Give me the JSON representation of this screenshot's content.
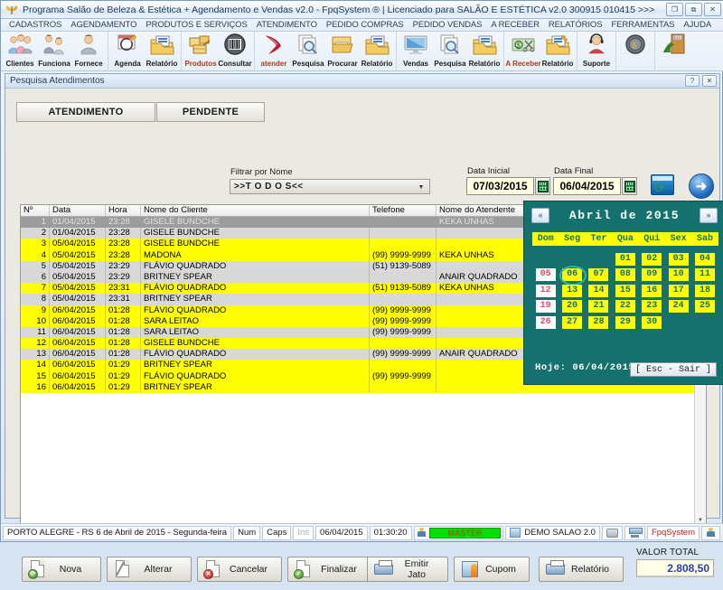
{
  "window": {
    "title": "Programa Salão de Beleza & Estética + Agendamento e Vendas v2.0 - FpqSystem ® | Licenciado para  SALÃO E ESTÉTICA v2.0 300915 010415 >>>",
    "app_icon": "butterfly-icon",
    "buttons": {
      "minimize": "❐",
      "maximize": "⧉",
      "close": "✕"
    }
  },
  "menubar": [
    "CADASTROS",
    "AGENDAMENTO",
    "PRODUTOS E SERVIÇOS",
    "ATENDIMENTO",
    "PEDIDO COMPRAS",
    "PEDIDO VENDAS",
    "A RECEBER",
    "RELATÓRIOS",
    "FERRAMENTAS",
    "AJUDA"
  ],
  "toolbar": {
    "groups": [
      {
        "items": [
          {
            "label": "Clientes",
            "icon": "clients-group-icon",
            "red": false
          },
          {
            "label": "Funciona",
            "icon": "employees-icon",
            "red": false
          },
          {
            "label": "Fornece",
            "icon": "supplier-icon",
            "red": false
          }
        ]
      },
      {
        "items": [
          {
            "label": "Agenda",
            "icon": "calendar-pencil-icon",
            "red": false
          },
          {
            "label": "Relatório",
            "icon": "report-folder-icon",
            "red": false
          }
        ]
      },
      {
        "items": [
          {
            "label": "Produtos",
            "icon": "boxes-icon",
            "red": true
          },
          {
            "label": "Consultar",
            "icon": "barcode-icon",
            "red": false
          }
        ]
      },
      {
        "items": [
          {
            "label": "atender",
            "icon": "red-ribbon-icon",
            "red": true
          },
          {
            "label": "Pesquisa",
            "icon": "search-docs-icon",
            "red": false
          },
          {
            "label": "Procurar",
            "icon": "open-folder-icon",
            "red": false
          },
          {
            "label": "Relatório",
            "icon": "report-folder-icon",
            "red": false
          }
        ]
      },
      {
        "items": [
          {
            "label": "Vendas",
            "icon": "monitor-icon",
            "red": false
          },
          {
            "label": "Pesquisa",
            "icon": "search-docs-icon",
            "red": false
          },
          {
            "label": "Relatório",
            "icon": "report-folder-icon",
            "red": false
          }
        ]
      },
      {
        "items": [
          {
            "label": "A Receber",
            "icon": "money-scissors-icon",
            "red": true
          },
          {
            "label": "Relatório",
            "icon": "report-folder-gear-icon",
            "red": false
          }
        ]
      },
      {
        "items": [
          {
            "label": "Suporte",
            "icon": "headset-support-icon",
            "red": false
          }
        ]
      },
      {
        "items": [
          {
            "label": "",
            "icon": "coin-icon",
            "red": false
          }
        ]
      },
      {
        "items": [
          {
            "label": "",
            "icon": "exit-door-icon",
            "red": false
          }
        ]
      }
    ]
  },
  "child_window": {
    "title": "Pesquisa Atendimentos",
    "help_button": "?",
    "close_button": "✕",
    "tabs": [
      {
        "id": "atendimento",
        "label": "ATENDIMENTO",
        "active": true
      },
      {
        "id": "pendente",
        "label": "PENDENTE",
        "active": false
      }
    ],
    "filter": {
      "label": "Filtrar por Nome",
      "value": ">>T O D O S<<",
      "placeholder": ">>T O D O S<<"
    },
    "date_initial": {
      "label": "Data Inicial",
      "value": "07/03/2015"
    },
    "date_final": {
      "label": "Data Final",
      "value": "06/04/2015"
    },
    "refresh_icon": "refresh-window-icon",
    "go_icon": "arrow-right-circle-icon"
  },
  "grid": {
    "columns": [
      "Nº",
      "Data",
      "Hora",
      "Nome do Cliente",
      "Telefone",
      "Nome do Atendente"
    ],
    "rows": [
      {
        "n": "1",
        "data": "01/04/2015",
        "hora": "23:28",
        "cliente": "GISELE BUNDCHE",
        "tel": "",
        "atendente": "KEKA UNHAS",
        "style": "sel"
      },
      {
        "n": "2",
        "data": "01/04/2015",
        "hora": "23:28",
        "cliente": "GISELE BUNDCHE",
        "tel": "",
        "atendente": "",
        "style": "grey"
      },
      {
        "n": "3",
        "data": "05/04/2015",
        "hora": "23:28",
        "cliente": "GISELE BUNDCHE",
        "tel": "",
        "atendente": "",
        "style": "yellow"
      },
      {
        "n": "4",
        "data": "05/04/2015",
        "hora": "23:28",
        "cliente": "MADONA",
        "tel": "(99) 9999-9999",
        "atendente": "KEKA UNHAS",
        "style": "yellow"
      },
      {
        "n": "5",
        "data": "05/04/2015",
        "hora": "23:29",
        "cliente": "FLÁVIO QUADRADO",
        "tel": "(51) 9139-5089",
        "atendente": "",
        "style": "grey"
      },
      {
        "n": "6",
        "data": "05/04/2015",
        "hora": "23:29",
        "cliente": "BRITNEY SPEAR",
        "tel": "",
        "atendente": "ANAIR QUADRADO",
        "style": "grey"
      },
      {
        "n": "7",
        "data": "05/04/2015",
        "hora": "23:31",
        "cliente": "FLÁVIO QUADRADO",
        "tel": "(51) 9139-5089",
        "atendente": "KEKA UNHAS",
        "style": "yellow"
      },
      {
        "n": "8",
        "data": "05/04/2015",
        "hora": "23:31",
        "cliente": "BRITNEY SPEAR",
        "tel": "",
        "atendente": "",
        "style": "grey"
      },
      {
        "n": "9",
        "data": "06/04/2015",
        "hora": "01:28",
        "cliente": "FLÁVIO QUADRADO",
        "tel": "(99) 9999-9999",
        "atendente": "",
        "style": "yellow"
      },
      {
        "n": "10",
        "data": "06/04/2015",
        "hora": "01:28",
        "cliente": "SARA LEITAO",
        "tel": "(99) 9999-9999",
        "atendente": "",
        "style": "yellow"
      },
      {
        "n": "11",
        "data": "06/04/2015",
        "hora": "01:28",
        "cliente": "SARA LEITAO",
        "tel": "(99) 9999-9999",
        "atendente": "",
        "style": "grey"
      },
      {
        "n": "12",
        "data": "06/04/2015",
        "hora": "01:28",
        "cliente": "GISELE BUNDCHE",
        "tel": "",
        "atendente": "",
        "style": "yellow"
      },
      {
        "n": "13",
        "data": "06/04/2015",
        "hora": "01:28",
        "cliente": "FLÁVIO QUADRADO",
        "tel": "(99) 9999-9999",
        "atendente": "ANAIR QUADRADO",
        "style": "grey"
      },
      {
        "n": "14",
        "data": "06/04/2015",
        "hora": "01:29",
        "cliente": "BRITNEY SPEAR",
        "tel": "",
        "atendente": "",
        "style": "yellow"
      },
      {
        "n": "15",
        "data": "06/04/2015",
        "hora": "01:29",
        "cliente": "FLÁVIO QUADRADO",
        "tel": "(99) 9999-9999",
        "atendente": "",
        "style": "yellow"
      },
      {
        "n": "16",
        "data": "06/04/2015",
        "hora": "01:29",
        "cliente": "BRITNEY SPEAR",
        "tel": "",
        "atendente": "",
        "style": "yellow"
      }
    ]
  },
  "calendar": {
    "title": "Abril de 2015",
    "prev_label": "«",
    "next_label": "»",
    "dow": [
      "Dom",
      "Seg",
      "Ter",
      "Qua",
      "Qui",
      "Sex",
      "Sab"
    ],
    "weeks": [
      [
        "",
        "",
        "",
        "01",
        "02",
        "03",
        "04"
      ],
      [
        "05",
        "06",
        "07",
        "08",
        "09",
        "10",
        "11"
      ],
      [
        "12",
        "13",
        "14",
        "15",
        "16",
        "17",
        "18"
      ],
      [
        "19",
        "20",
        "21",
        "22",
        "23",
        "24",
        "25"
      ],
      [
        "26",
        "27",
        "28",
        "29",
        "30",
        "",
        ""
      ]
    ],
    "today": "06",
    "today_label": "Hoje: 06/04/2015",
    "esc_label": "[ Esc - Sair ]",
    "colors": {
      "background": "#14716e",
      "day_cell": "#ffff00",
      "sunday_text": "#e04a6e",
      "highlight_ring": "#2ab9a6"
    }
  },
  "actions": [
    {
      "id": "nova",
      "label": "Nova",
      "icon": "new-page-refresh-icon"
    },
    {
      "id": "alterar",
      "label": "Alterar",
      "icon": "edit-pencil-icon"
    },
    {
      "id": "cancelar",
      "label": "Cancelar",
      "icon": "page-delete-icon"
    },
    {
      "id": "finalizar",
      "label": "Finalizar",
      "icon": "page-check-icon"
    },
    {
      "id": "emitir",
      "label": "Emitir Jato",
      "icon": "printer-icon"
    },
    {
      "id": "cupom",
      "label": "Cupom",
      "icon": "coupon-printer-icon"
    },
    {
      "id": "relatorio",
      "label": "Relatório",
      "icon": "printer-icon"
    }
  ],
  "total": {
    "label": "VALOR TOTAL",
    "value": "2.808,50",
    "color": "#2b3ea8"
  },
  "statusbar": {
    "location": "PORTO ALEGRE - RS  6 de Abril de 2015 - Segunda-feira",
    "num": "Num",
    "caps": "Caps",
    "ins": "Ins",
    "date": "06/04/2015",
    "time": "01:30:20",
    "user": "MASTER",
    "database": "DEMO SALAO 2.0",
    "brand": "FpqSystem"
  }
}
